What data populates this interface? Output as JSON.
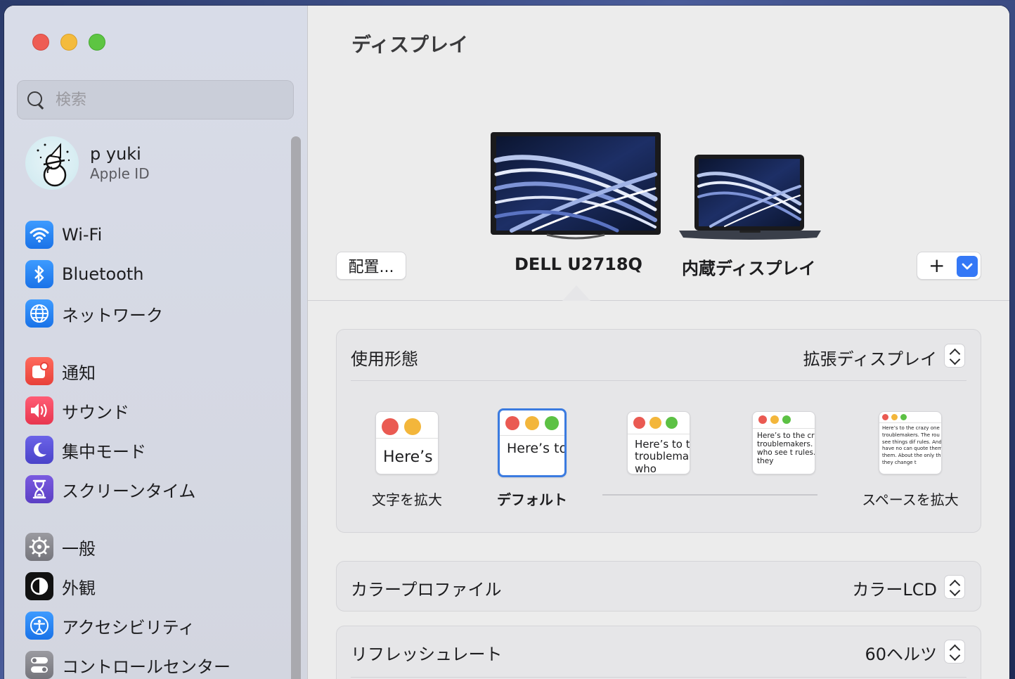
{
  "window": {
    "traffic_lights": [
      "close",
      "minimize",
      "zoom"
    ]
  },
  "sidebar": {
    "search_placeholder": "検索",
    "profile": {
      "name": "p yuki",
      "subtitle": "Apple ID"
    },
    "items": [
      {
        "label": "Wi-Fi",
        "icon": "wifi-icon",
        "color": "#1a73e8"
      },
      {
        "label": "Bluetooth",
        "icon": "bluetooth-icon",
        "color": "#1a73e8"
      },
      {
        "label": "ネットワーク",
        "icon": "globe-icon",
        "color": "#1a73e8"
      },
      {
        "label": "通知",
        "icon": "bell-icon",
        "color": "#e8413a"
      },
      {
        "label": "サウンド",
        "icon": "speaker-icon",
        "color": "#e8364f"
      },
      {
        "label": "集中モード",
        "icon": "moon-icon",
        "color": "#4a43c9"
      },
      {
        "label": "スクリーンタイム",
        "icon": "hourglass-icon",
        "color": "#5b3fc4"
      },
      {
        "label": "一般",
        "icon": "gear-icon",
        "color": "#75757c"
      },
      {
        "label": "外観",
        "icon": "appearance-icon",
        "color": "#111111"
      },
      {
        "label": "アクセシビリティ",
        "icon": "accessibility-icon",
        "color": "#1a73e8"
      },
      {
        "label": "コントロールセンター",
        "icon": "toggles-icon",
        "color": "#75757c"
      }
    ]
  },
  "main": {
    "title": "ディスプレイ",
    "arrange_button": "配置...",
    "add_button": "+",
    "displays": [
      {
        "label": "DELL U2718Q",
        "selected": true
      },
      {
        "label": "内蔵ディスプレイ",
        "selected": false
      }
    ],
    "use_as": {
      "label": "使用形態",
      "value": "拡張ディスプレイ"
    },
    "resolution": {
      "options": [
        {
          "thumb_text": "Here’s",
          "label": "文字を拡大",
          "selected": false
        },
        {
          "thumb_text": "Here’s to troublem",
          "label": "デフォルト",
          "selected": true
        },
        {
          "thumb_text": "Here’s to t troublema ones who",
          "label": "",
          "selected": false
        },
        {
          "thumb_text": "Here’s to the cr troublemakers. ones who see t rules. And they",
          "label": "",
          "selected": false
        },
        {
          "thumb_text": "Here’s to the crazy one troublemakers. The rou ones who see things dif rules. And they have no can quote them, disagre them. About the only th Because they change t",
          "label": "スペースを拡大",
          "selected": false
        }
      ]
    },
    "color_profile": {
      "label": "カラープロファイル",
      "value": "カラーLCD"
    },
    "refresh_rate": {
      "label": "リフレッシュレート",
      "value": "60ヘルツ"
    }
  }
}
